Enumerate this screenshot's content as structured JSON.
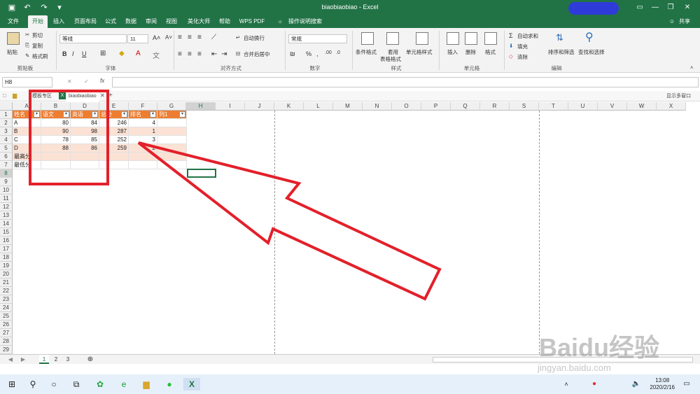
{
  "window": {
    "title": "biaobiaobiao  -  Excel"
  },
  "menu": {
    "tabs": [
      "文件",
      "开始",
      "插入",
      "页面布局",
      "公式",
      "数据",
      "审阅",
      "视图",
      "美化大师",
      "帮助",
      "WPS PDF",
      "操作说明搜索"
    ],
    "share": "共享"
  },
  "ribbon": {
    "clipboard": {
      "paste": "粘贴",
      "cut": "剪切",
      "copy": "复制",
      "format_painter": "格式刷",
      "label": "剪贴板"
    },
    "font": {
      "name": "等线",
      "size": "11",
      "label": "字体"
    },
    "align": {
      "wrap": "自动换行",
      "merge": "合并后居中",
      "label": "对齐方式"
    },
    "number": {
      "format": "常规",
      "label": "数字"
    },
    "styles": {
      "conditional": "条件格式",
      "table": "套用",
      "table2": "表格格式",
      "cell": "单元格样式",
      "label": "样式"
    },
    "cells": {
      "insert": "插入",
      "delete": "删除",
      "format": "格式",
      "label": "单元格"
    },
    "editing": {
      "autosum": "自动求和",
      "fill": "填充",
      "clear": "清除",
      "sort": "排序和筛选",
      "find": "查找和选择",
      "label": "编辑"
    }
  },
  "formula": {
    "namebox": "H8",
    "fx": "fx"
  },
  "doctabs": {
    "tab1": "模板专区",
    "tab2": "biaobiaobiao",
    "right": "显示多窗口"
  },
  "columns": [
    "A",
    "B",
    "D",
    "E",
    "F",
    "G",
    "H",
    "I",
    "J",
    "K",
    "L",
    "M",
    "N",
    "O",
    "P",
    "Q",
    "R",
    "S",
    "T",
    "U",
    "V",
    "W",
    "X"
  ],
  "rows": [
    "1",
    "2",
    "3",
    "4",
    "5",
    "6",
    "7",
    "8",
    "9",
    "10",
    "11",
    "12",
    "13",
    "14",
    "15",
    "16",
    "17",
    "18",
    "19",
    "20",
    "21",
    "22",
    "23",
    "24",
    "25",
    "26",
    "27",
    "28",
    "29"
  ],
  "table": {
    "headers": [
      "姓名",
      "语文",
      "英语",
      "总分",
      "排名",
      "列1"
    ],
    "data": [
      [
        "A",
        "80",
        "84",
        "246",
        "4"
      ],
      [
        "B",
        "90",
        "98",
        "287",
        "1"
      ],
      [
        "C",
        "78",
        "85",
        "252",
        "3"
      ],
      [
        "D",
        "88",
        "86",
        "259",
        "2"
      ]
    ],
    "extra": [
      "最高分",
      "最低分"
    ]
  },
  "sheets": [
    "1",
    "2",
    "3"
  ],
  "taskbar": {
    "time": "13:08",
    "date": "2020/2/16"
  },
  "watermark": {
    "brand": "Baidu经验",
    "url": "jingyan.baidu.com"
  },
  "colors": {
    "excel_green": "#217346",
    "header_orange": "#ed7d31",
    "band": "#fbe2d5",
    "annotation_red": "#e3202a"
  }
}
